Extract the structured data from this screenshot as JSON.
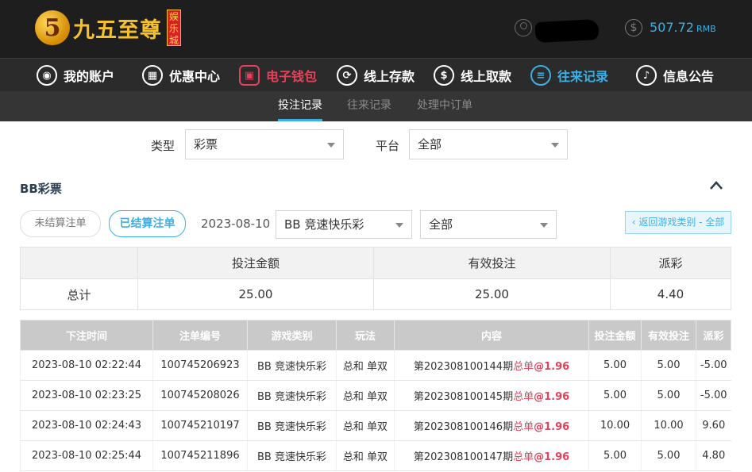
{
  "header": {
    "logo_numeral": "5",
    "logo_text": "九五至尊",
    "logo_badge": "娱乐城",
    "balance": "507.72",
    "currency": "RMB"
  },
  "nav": [
    {
      "label": "我的账户",
      "icon": "user-icon",
      "glyph": "◉"
    },
    {
      "label": "优惠中心",
      "icon": "gift-icon",
      "glyph": "▦"
    },
    {
      "label": "电子钱包",
      "icon": "wallet-icon",
      "glyph": "▣"
    },
    {
      "label": "线上存款",
      "icon": "deposit-icon",
      "glyph": "⟳"
    },
    {
      "label": "线上取款",
      "icon": "withdraw-icon",
      "glyph": "$"
    },
    {
      "label": "往来记录",
      "icon": "records-icon",
      "glyph": "≡"
    },
    {
      "label": "信息公告",
      "icon": "bell-icon",
      "glyph": "♪"
    }
  ],
  "subnav": [
    "投注记录",
    "往来记录",
    "处理中订单"
  ],
  "filters": {
    "type_label": "类型",
    "type_value": "彩票",
    "platform_label": "平台",
    "platform_value": "全部"
  },
  "section_title": "BB彩票",
  "controls": {
    "unsettled": "未结算注单",
    "settled": "已结算注单",
    "date": "2023-08-10",
    "game_select": "BB 竞速快乐彩",
    "play_select": "全部",
    "back": "‹ 返回游戏类别 - 全部"
  },
  "summary": {
    "headers": [
      "投注金额",
      "有效投注",
      "派彩"
    ],
    "row_label": "总计",
    "values": [
      "25.00",
      "25.00",
      "4.40"
    ]
  },
  "table": {
    "headers": [
      "下注时间",
      "注单编号",
      "游戏类别",
      "玩法",
      "内容",
      "投注金额",
      "有效投注",
      "派彩"
    ],
    "rows": [
      {
        "time": "2023-08-10 02:22:44",
        "id": "100745206923",
        "game": "BB 竞速快乐彩",
        "play": "总和 单双",
        "issue": "第202308100144期",
        "pick": "总单",
        "odds": "@1.96",
        "bet": "5.00",
        "valid": "5.00",
        "payout": "-5.00"
      },
      {
        "time": "2023-08-10 02:23:25",
        "id": "100745208026",
        "game": "BB 竞速快乐彩",
        "play": "总和 单双",
        "issue": "第202308100145期",
        "pick": "总单",
        "odds": "@1.96",
        "bet": "5.00",
        "valid": "5.00",
        "payout": "-5.00"
      },
      {
        "time": "2023-08-10 02:24:43",
        "id": "100745210197",
        "game": "BB 竞速快乐彩",
        "play": "总和 单双",
        "issue": "第202308100146期",
        "pick": "总单",
        "odds": "@1.96",
        "bet": "10.00",
        "valid": "10.00",
        "payout": "9.60"
      },
      {
        "time": "2023-08-10 02:25:44",
        "id": "100745211896",
        "game": "BB 竞速快乐彩",
        "play": "总和 单双",
        "issue": "第202308100147期",
        "pick": "总单",
        "odds": "@1.96",
        "bet": "5.00",
        "valid": "5.00",
        "payout": "4.80"
      }
    ]
  }
}
